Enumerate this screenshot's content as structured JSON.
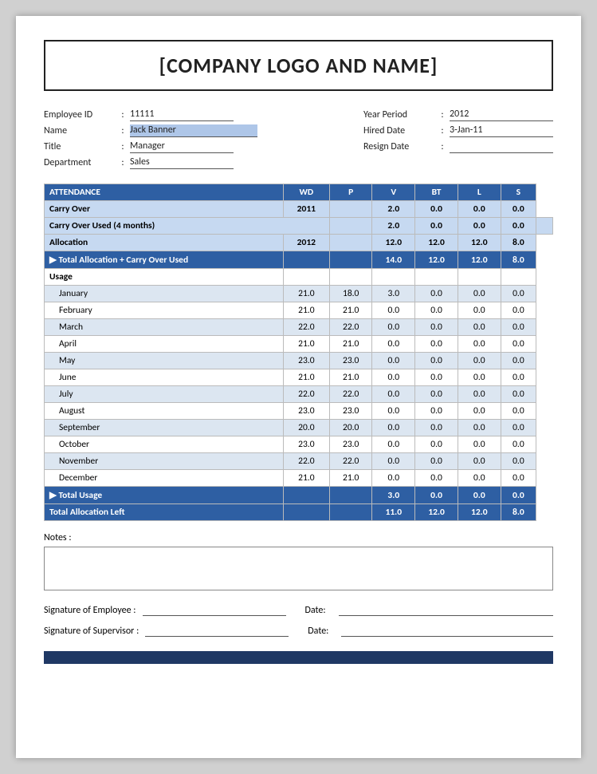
{
  "header": {
    "company_text": "[COMPANY LOGO AND NAME]"
  },
  "employee_info": {
    "left": [
      {
        "label": "Employee ID",
        "value": "11111",
        "style": "underline"
      },
      {
        "label": "Name",
        "value": "Jack Banner",
        "style": "blue-bg"
      },
      {
        "label": "Title",
        "value": "Manager",
        "style": "underline"
      },
      {
        "label": "Department",
        "value": "Sales",
        "style": "underline"
      }
    ],
    "right": [
      {
        "label": "Year Period",
        "value": "2012",
        "style": "underline"
      },
      {
        "label": "Hired Date",
        "value": "3-Jan-11",
        "style": "underline"
      },
      {
        "label": "Resign Date",
        "value": "",
        "style": "underline"
      }
    ]
  },
  "table": {
    "columns": [
      "ATTENDANCE",
      "WD",
      "P",
      "V",
      "BT",
      "L",
      "S"
    ],
    "rows": [
      {
        "type": "blue",
        "cells": [
          "Carry Over",
          "2011",
          "",
          "2.0",
          "0.0",
          "0.0",
          "0.0"
        ]
      },
      {
        "type": "blue",
        "cells": [
          "Carry Over Used (4 months)",
          "",
          "",
          "2.0",
          "0.0",
          "0.0",
          "0.0"
        ]
      },
      {
        "type": "blue",
        "cells": [
          "Allocation",
          "2012",
          "",
          "12.0",
          "12.0",
          "12.0",
          "8.0"
        ]
      },
      {
        "type": "total",
        "cells": [
          "▶ Total Allocation + Carry Over Used",
          "",
          "",
          "14.0",
          "12.0",
          "12.0",
          "8.0"
        ]
      },
      {
        "type": "usage-header",
        "cells": [
          "Usage",
          "",
          "",
          "",
          "",
          "",
          ""
        ]
      },
      {
        "type": "light",
        "cells": [
          "January",
          "21.0",
          "18.0",
          "3.0",
          "0.0",
          "0.0",
          "0.0"
        ]
      },
      {
        "type": "white",
        "cells": [
          "February",
          "21.0",
          "21.0",
          "0.0",
          "0.0",
          "0.0",
          "0.0"
        ]
      },
      {
        "type": "light",
        "cells": [
          "March",
          "22.0",
          "22.0",
          "0.0",
          "0.0",
          "0.0",
          "0.0"
        ]
      },
      {
        "type": "white",
        "cells": [
          "April",
          "21.0",
          "21.0",
          "0.0",
          "0.0",
          "0.0",
          "0.0"
        ]
      },
      {
        "type": "light",
        "cells": [
          "May",
          "23.0",
          "23.0",
          "0.0",
          "0.0",
          "0.0",
          "0.0"
        ]
      },
      {
        "type": "white",
        "cells": [
          "June",
          "21.0",
          "21.0",
          "0.0",
          "0.0",
          "0.0",
          "0.0"
        ]
      },
      {
        "type": "light",
        "cells": [
          "July",
          "22.0",
          "22.0",
          "0.0",
          "0.0",
          "0.0",
          "0.0"
        ]
      },
      {
        "type": "white",
        "cells": [
          "August",
          "23.0",
          "23.0",
          "0.0",
          "0.0",
          "0.0",
          "0.0"
        ]
      },
      {
        "type": "light",
        "cells": [
          "September",
          "20.0",
          "20.0",
          "0.0",
          "0.0",
          "0.0",
          "0.0"
        ]
      },
      {
        "type": "white",
        "cells": [
          "October",
          "23.0",
          "23.0",
          "0.0",
          "0.0",
          "0.0",
          "0.0"
        ]
      },
      {
        "type": "light",
        "cells": [
          "November",
          "22.0",
          "22.0",
          "0.0",
          "0.0",
          "0.0",
          "0.0"
        ]
      },
      {
        "type": "white",
        "cells": [
          "December",
          "21.0",
          "21.0",
          "0.0",
          "0.0",
          "0.0",
          "0.0"
        ]
      },
      {
        "type": "total",
        "cells": [
          "▶ Total Usage",
          "",
          "",
          "3.0",
          "0.0",
          "0.0",
          "0.0"
        ]
      },
      {
        "type": "total-alloc",
        "cells": [
          "Total Allocation Left",
          "",
          "",
          "11.0",
          "12.0",
          "12.0",
          "8.0"
        ]
      }
    ]
  },
  "notes": {
    "label": "Notes :"
  },
  "signatures": {
    "employee_label": "Signature of Employee :",
    "supervisor_label": "Signature of Supervisor :",
    "date_label": "Date:"
  }
}
